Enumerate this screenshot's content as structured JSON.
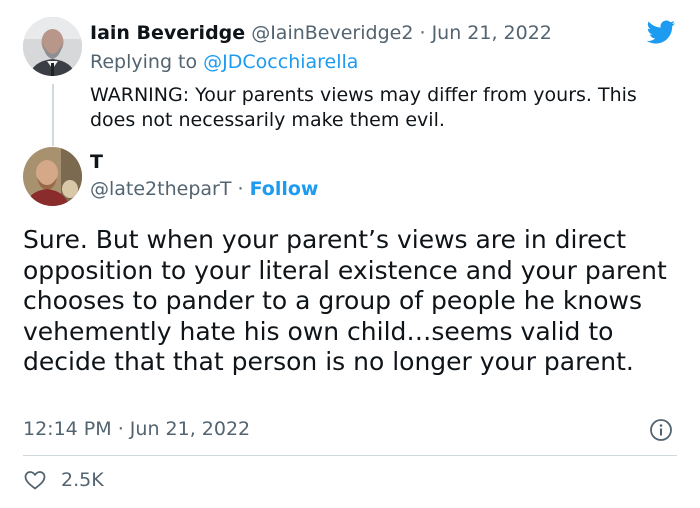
{
  "parent_tweet": {
    "author_name": "Iain Beveridge",
    "author_handle": "@IainBeveridge2",
    "separator": "·",
    "date": "Jun 21, 2022",
    "replying_prefix": "Replying to",
    "replying_to": "@JDCocchiarella",
    "text": "WARNING: Your parents views may differ from yours. This does not necessarily make them evil."
  },
  "main_tweet": {
    "author_name": "T",
    "author_handle": "@late2theparT",
    "separator": "·",
    "follow_label": "Follow",
    "text": "Sure. But when your parent’s views are in direct opposition to your literal existence and your parent chooses to pander to a group of people he knows vehemently hate his own child…seems valid to decide that that person is no longer your parent.",
    "time": "12:14 PM",
    "date": "Jun 21, 2022",
    "likes": "2.5K"
  },
  "icons": {
    "brand": "twitter-bird-icon",
    "info": "info-icon",
    "like": "heart-icon"
  },
  "colors": {
    "brand_blue": "#1d9bf0",
    "text": "#0f1419",
    "muted": "#536471",
    "border": "#cfd9de"
  }
}
